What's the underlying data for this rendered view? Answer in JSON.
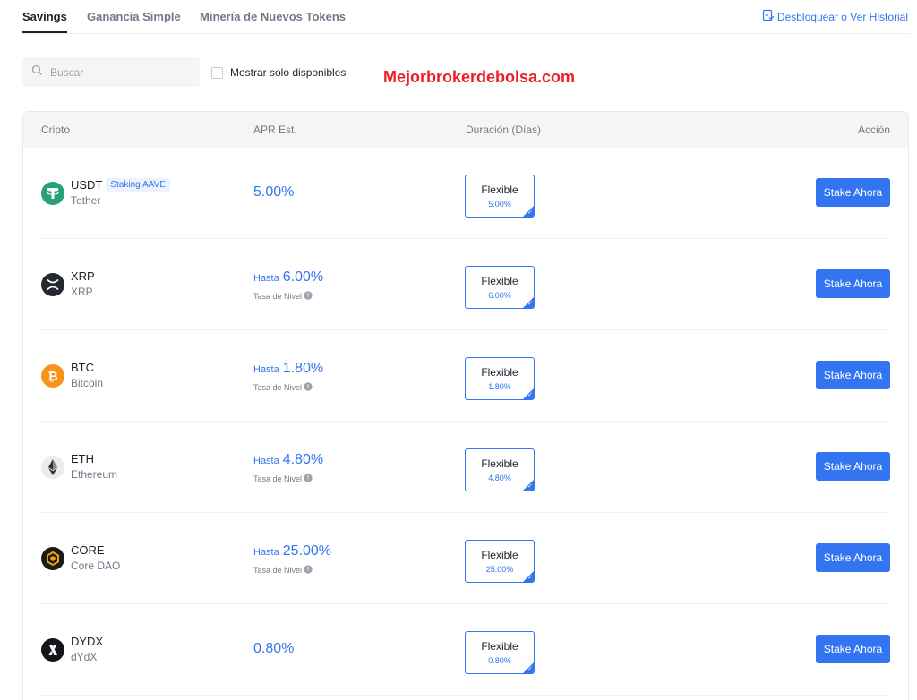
{
  "tabs": [
    {
      "label": "Savings",
      "active": true
    },
    {
      "label": "Ganancia Simple",
      "active": false
    },
    {
      "label": "Minería de Nuevos Tokens",
      "active": false
    }
  ],
  "history_link": {
    "label": "Desbloquear o Ver Historial",
    "icon": "history-list-icon"
  },
  "search": {
    "placeholder": "Buscar",
    "value": ""
  },
  "filter_checkbox": {
    "label": "Mostrar solo disponibles",
    "checked": false
  },
  "watermark": "Mejorbrokerdebolsa.com",
  "table": {
    "headers": {
      "crypto": "Cripto",
      "apr": "APR Est.",
      "duration": "Duración (Días)",
      "action": "Acción"
    },
    "rows": [
      {
        "symbol": "USDT",
        "name": "Tether",
        "badge": "Staking AAVE",
        "apr_prefix": "",
        "apr": "5.00%",
        "apr_note": "",
        "duration_label": "Flexible",
        "duration_value": "5.00%",
        "action": "Stake Ahora",
        "icon": "tether-icon",
        "icon_color": "#26a17b"
      },
      {
        "symbol": "XRP",
        "name": "XRP",
        "badge": "",
        "apr_prefix": "Hasta",
        "apr": "6.00%",
        "apr_note": "Tasa de Nivel",
        "duration_label": "Flexible",
        "duration_value": "6.00%",
        "action": "Stake Ahora",
        "icon": "xrp-icon",
        "icon_color": "#23292f"
      },
      {
        "symbol": "BTC",
        "name": "Bitcoin",
        "badge": "",
        "apr_prefix": "Hasta",
        "apr": "1.80%",
        "apr_note": "Tasa de Nivel",
        "duration_label": "Flexible",
        "duration_value": "1.80%",
        "action": "Stake Ahora",
        "icon": "bitcoin-icon",
        "icon_color": "#f7931a"
      },
      {
        "symbol": "ETH",
        "name": "Ethereum",
        "badge": "",
        "apr_prefix": "Hasta",
        "apr": "4.80%",
        "apr_note": "Tasa de Nivel",
        "duration_label": "Flexible",
        "duration_value": "4.80%",
        "action": "Stake Ahora",
        "icon": "ethereum-icon",
        "icon_color": "#ececec"
      },
      {
        "symbol": "CORE",
        "name": "Core DAO",
        "badge": "",
        "apr_prefix": "Hasta",
        "apr": "25.00%",
        "apr_note": "Tasa de Nivel",
        "duration_label": "Flexible",
        "duration_value": "25.00%",
        "action": "Stake Ahora",
        "icon": "core-icon",
        "icon_color": "#1a1a1a"
      },
      {
        "symbol": "DYDX",
        "name": "dYdX",
        "badge": "",
        "apr_prefix": "",
        "apr": "0.80%",
        "apr_note": "",
        "duration_label": "Flexible",
        "duration_value": "0.80%",
        "action": "Stake Ahora",
        "icon": "dydx-icon",
        "icon_color": "#14151a"
      }
    ]
  },
  "colors": {
    "accent": "#3375f0",
    "text": "#1e2329",
    "muted": "#707a8a",
    "watermark": "#e8202a"
  }
}
